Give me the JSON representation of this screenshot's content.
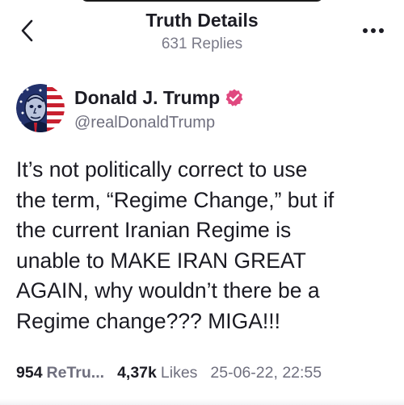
{
  "header": {
    "title": "Truth Details",
    "subtitle": "631 Replies",
    "back_icon": "chevron-left-icon",
    "more_icon": "more-horizontal-icon"
  },
  "author": {
    "name": "Donald J. Trump",
    "handle": "@realDonaldTrump",
    "verified": true,
    "verified_color": "#e0487f"
  },
  "post": {
    "text": "It’s not politically correct to use\nthe term, “Regime Change,” but if\nthe current Iranian Regime is\nunable to MAKE IRAN GREAT\nAGAIN, why wouldn’t there be a\nRegime change??? MIGA!!!"
  },
  "stats": {
    "retruths_count": "954",
    "retruths_label": "ReTru...",
    "likes_count": "4,37k",
    "likes_label": "Likes",
    "timestamp": "25-06-22, 22:55"
  },
  "colors": {
    "accent": "#e0487f",
    "text_primary": "#1c1c24",
    "text_secondary": "#6f6f7e"
  }
}
